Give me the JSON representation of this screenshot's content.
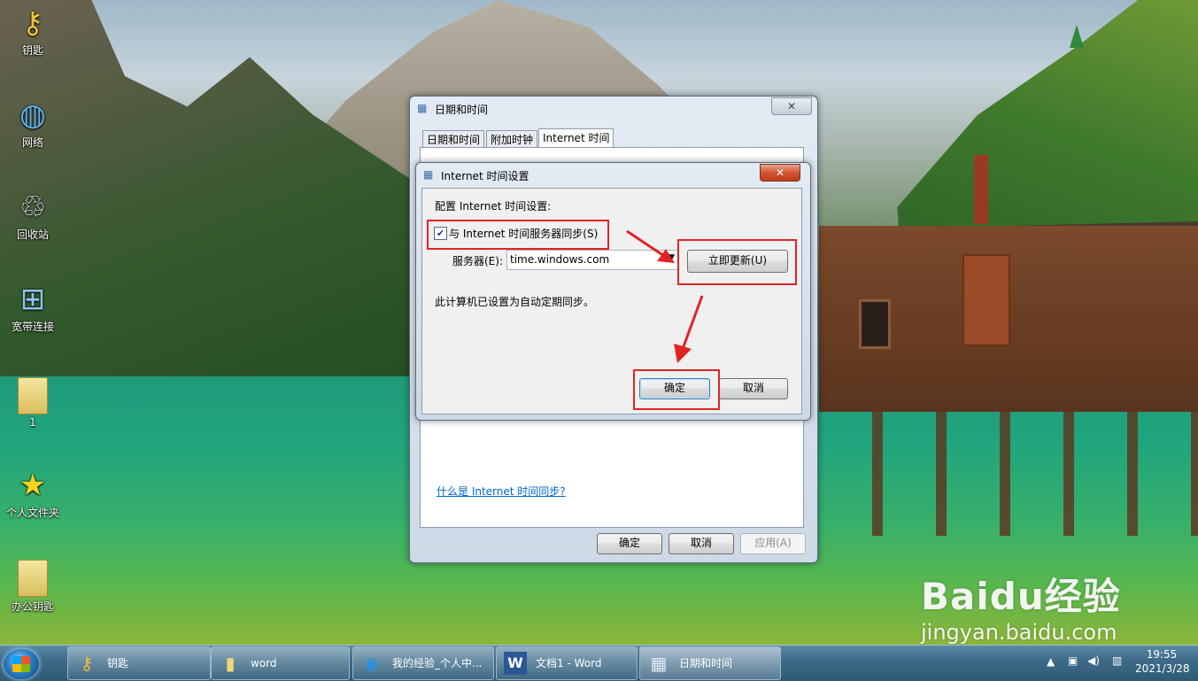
{
  "desktop": {
    "icons": [
      {
        "label": "钥匙",
        "icon": "key-icon"
      },
      {
        "label": "网络",
        "icon": "network-globe-icon"
      },
      {
        "label": "回收站",
        "icon": "recycle-bin-icon"
      },
      {
        "label": "宽带连接",
        "icon": "broadband-connection-icon"
      },
      {
        "label": "1",
        "icon": "folder-icon"
      },
      {
        "label": "个人文件夹",
        "icon": "star-icon"
      },
      {
        "label": "办公钥匙",
        "icon": "folder-icon"
      }
    ]
  },
  "bg_dialog": {
    "title": "日期和时间",
    "tabs": [
      "日期和时间",
      "附加时钟",
      "Internet 时间"
    ],
    "link": "什么是 Internet 时间同步?",
    "buttons": {
      "ok": "确定",
      "cancel": "取消",
      "apply": "应用(A)"
    }
  },
  "fg_dialog": {
    "title": "Internet 时间设置",
    "config_label": "配置 Internet 时间设置:",
    "sync_checkbox_label": "与 Internet 时间服务器同步(S)",
    "sync_checked": true,
    "server_label": "服务器(E):",
    "server_value": "time.windows.com",
    "update_button": "立即更新(U)",
    "status_text": "此计算机已设置为自动定期同步。",
    "ok_button": "确定",
    "cancel_button": "取消"
  },
  "taskbar": {
    "items": [
      {
        "label": "钥匙",
        "icon": "key-icon"
      },
      {
        "label": "word",
        "icon": "folder-icon"
      },
      {
        "label": "我的经验_个人中...",
        "icon": "browser-icon"
      },
      {
        "label": "文档1 - Word",
        "icon": "word-icon"
      },
      {
        "label": "日期和时间",
        "icon": "calendar-clock-icon"
      }
    ],
    "clock_time": "19:55",
    "clock_date": "2021/3/28"
  },
  "watermark": {
    "brand": "Baidu经验",
    "url": "jingyan.baidu.com"
  },
  "colors": {
    "highlight_box": "#e02424",
    "link": "#0066cc",
    "close_red": "#c23a1a"
  }
}
